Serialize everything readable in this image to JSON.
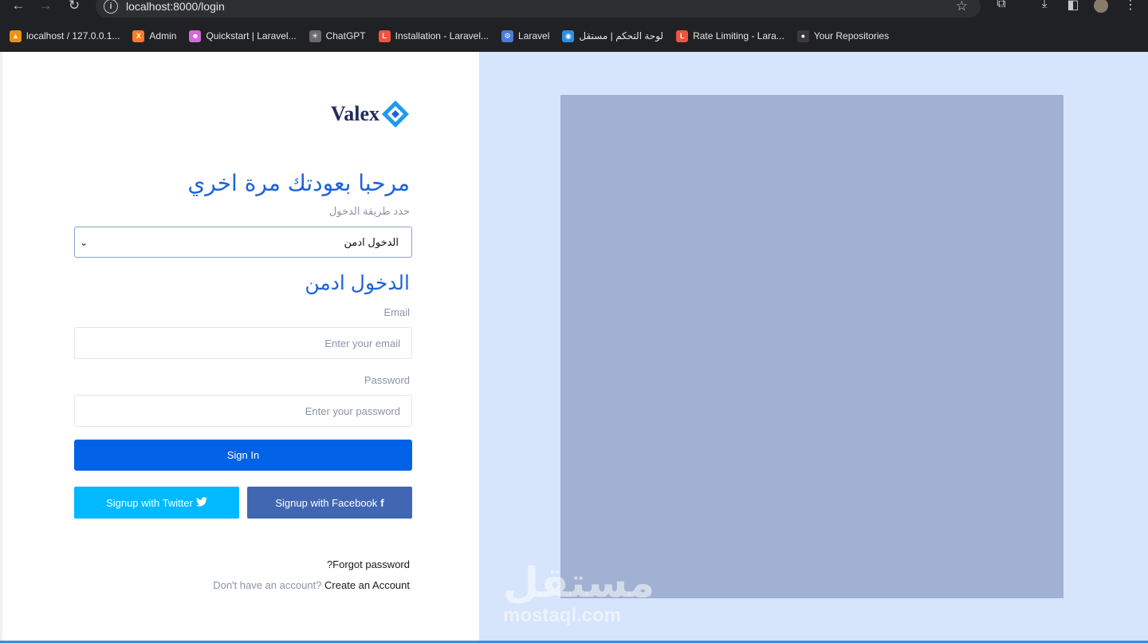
{
  "browser": {
    "url": "localhost:8000/login",
    "bookmarks": [
      {
        "label": "localhost / 127.0.0.1...",
        "color": "#f29111",
        "glyph": "▲"
      },
      {
        "label": "Admin",
        "color": "#fb7a24",
        "glyph": "X"
      },
      {
        "label": "Quickstart | Laravel...",
        "color": "#d46ad8",
        "glyph": "☻"
      },
      {
        "label": "ChatGPT",
        "color": "#6b6b6b",
        "glyph": "✳"
      },
      {
        "label": "Installation - Laravel...",
        "color": "#f05340",
        "glyph": "L"
      },
      {
        "label": "Laravel",
        "color": "#4c7bd6",
        "glyph": "⚙"
      },
      {
        "label": "لوحة التحكم | مستقل",
        "color": "#2d8fe0",
        "glyph": "◉"
      },
      {
        "label": "Rate Limiting - Lara...",
        "color": "#f05340",
        "glyph": "L"
      },
      {
        "label": "Your Repositories",
        "color": "#3a3a3a",
        "glyph": "●"
      }
    ]
  },
  "brand": {
    "name": "Valex",
    "accent": "#1f9bf0"
  },
  "login": {
    "welcome": "مرحبا بعودتك مرة اخري",
    "select_label": "حدد طريقة الدخول",
    "select_value": "الدخول ادمن",
    "heading": "الدخول ادمن",
    "email_label": "Email",
    "email_placeholder": "Enter your email",
    "password_label": "Password",
    "password_placeholder": "Enter your password",
    "signin_label": "Sign In",
    "twitter_label": "Signup with Twitter",
    "facebook_label": "Signup with Facebook",
    "forgot_label": "?Forgot password",
    "no_account_text": "Don't have an account?",
    "create_account_label": "Create an Account"
  },
  "watermark": {
    "arabic": "مستقل",
    "latin": "mostaql.com"
  },
  "colors": {
    "primary": "#0162e8",
    "twitter": "#00b9ff",
    "facebook": "#4267b2",
    "right_bg": "#d6e4fc",
    "illustration": "#a1b1d3"
  }
}
